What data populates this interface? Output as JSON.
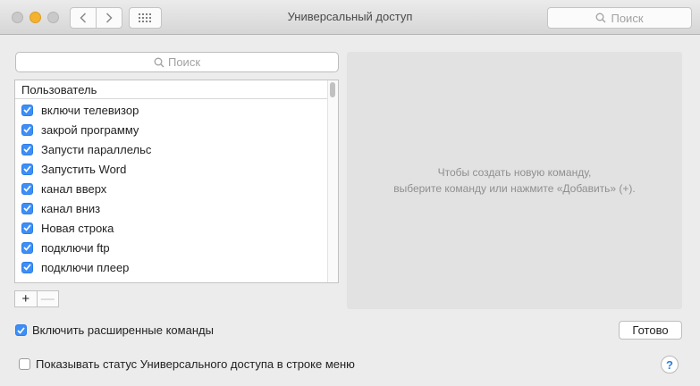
{
  "window": {
    "title": "Универсальный доступ"
  },
  "toolbar": {
    "search_placeholder": "Поиск"
  },
  "commands_search": {
    "placeholder": "Поиск"
  },
  "commands_list": {
    "header": "Пользователь",
    "items": [
      {
        "label": "включи телевизор",
        "checked": true
      },
      {
        "label": "закрой программу",
        "checked": true
      },
      {
        "label": "Запусти параллельс",
        "checked": true
      },
      {
        "label": "Запустить Word",
        "checked": true
      },
      {
        "label": "канал вверх",
        "checked": true
      },
      {
        "label": "канал вниз",
        "checked": true
      },
      {
        "label": "Новая строка",
        "checked": true
      },
      {
        "label": "подключи ftp",
        "checked": true
      },
      {
        "label": "подключи плеер",
        "checked": true
      }
    ]
  },
  "list_controls": {
    "add_label": "+",
    "remove_label": "—"
  },
  "detail": {
    "line1": "Чтобы создать новую команду,",
    "line2": "выберите команду или нажмите «Добавить» (+)."
  },
  "advanced": {
    "label": "Включить расширенные команды",
    "checked": true
  },
  "done_button": "Готово",
  "status_menu": {
    "label": "Показывать статус Универсального доступа в строке меню",
    "checked": false
  },
  "help": "?",
  "colors": {
    "accent": "#3d8ef7",
    "minimize": "#f4b22f"
  }
}
